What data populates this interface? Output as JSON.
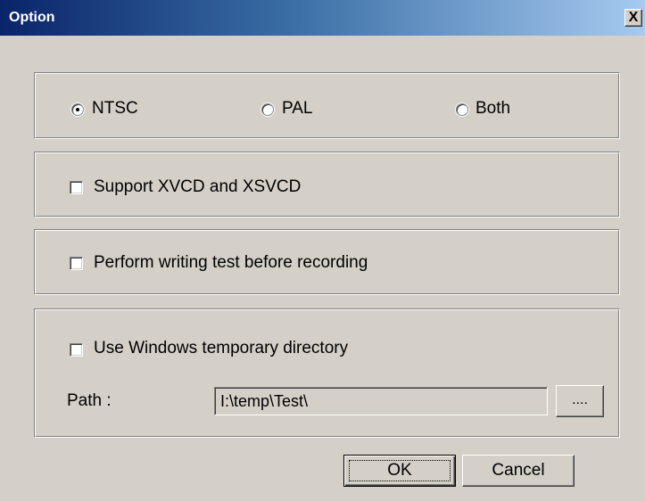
{
  "window": {
    "title": "Option",
    "close_glyph": "X"
  },
  "video_standard": {
    "options": [
      {
        "label": "NTSC",
        "selected": true
      },
      {
        "label": "PAL",
        "selected": false
      },
      {
        "label": "Both",
        "selected": false
      }
    ]
  },
  "checkboxes": {
    "xvcd": {
      "label": "Support XVCD and XSVCD",
      "checked": false
    },
    "writing_test": {
      "label": "Perform writing test before recording",
      "checked": false
    },
    "temp_dir": {
      "label": "Use Windows temporary directory",
      "checked": false
    }
  },
  "path": {
    "label": "Path :",
    "value": "I:\\temp\\Test\\",
    "browse_label": "...."
  },
  "buttons": {
    "ok_label": "OK",
    "cancel_label": "Cancel"
  }
}
